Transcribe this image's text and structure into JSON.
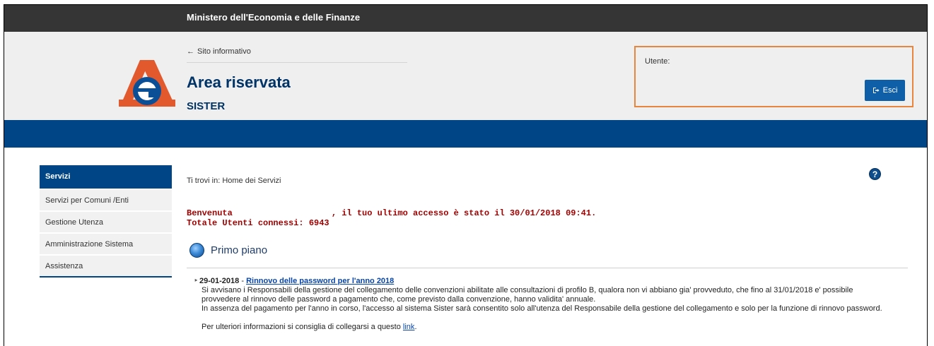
{
  "topbar": {
    "title": "Ministero dell'Economia e delle Finanze"
  },
  "header": {
    "back_link": "Sito informativo",
    "area_title": "Area riservata",
    "area_subtitle": "SISTER",
    "user_label": "Utente:",
    "logout_label": "Esci"
  },
  "sidebar": {
    "heading": "Servizi",
    "items": [
      {
        "label": "Servizi per Comuni /Enti"
      },
      {
        "label": "Gestione Utenza"
      },
      {
        "label": "Amministrazione Sistema"
      },
      {
        "label": "Assistenza"
      }
    ]
  },
  "main": {
    "breadcrumb": "Ti trovi in: Home dei Servizi",
    "welcome_prefix": "Benvenuta",
    "welcome_suffix": ", il tuo ultimo accesso è stato il 30/01/2018 09:41.",
    "connected_users": "Totale Utenti connessi: 6943",
    "section_title": "Primo piano",
    "news": {
      "date": "29-01-2018",
      "separator": " - ",
      "title": "Rinnovo delle password per l'anno 2018",
      "lines": [
        "Si avvisano i Responsabili della gestione del collegamento delle convenzioni abilitate alle consultazioni di profilo B, qualora non vi abbiano gia' provveduto, che fino al 31/01/2018 e' possibile",
        "provvedere al rinnovo delle password a pagamento che, come previsto dalla convenzione, hanno validita' annuale.",
        "In assenza del pagamento per l'anno in corso, l'accesso al sistema Sister sarà consentito solo all'utenza del Responsabile della gestione del collegamento e solo per la funzione di rinnovo password."
      ],
      "more_text": "Per ulteriori informazioni si consiglia di collegarsi a questo ",
      "more_link": "link",
      "more_end": "."
    }
  },
  "colors": {
    "topbar": "#353535",
    "brand_blue": "#004687",
    "alert_red": "#a30000",
    "box_border": "#e8853f"
  },
  "icons": {
    "back": "arrow-left-icon",
    "logout": "sign-out-icon",
    "help": "help-icon",
    "section": "globe-icon",
    "logo": "agenzia-entrate-logo"
  }
}
